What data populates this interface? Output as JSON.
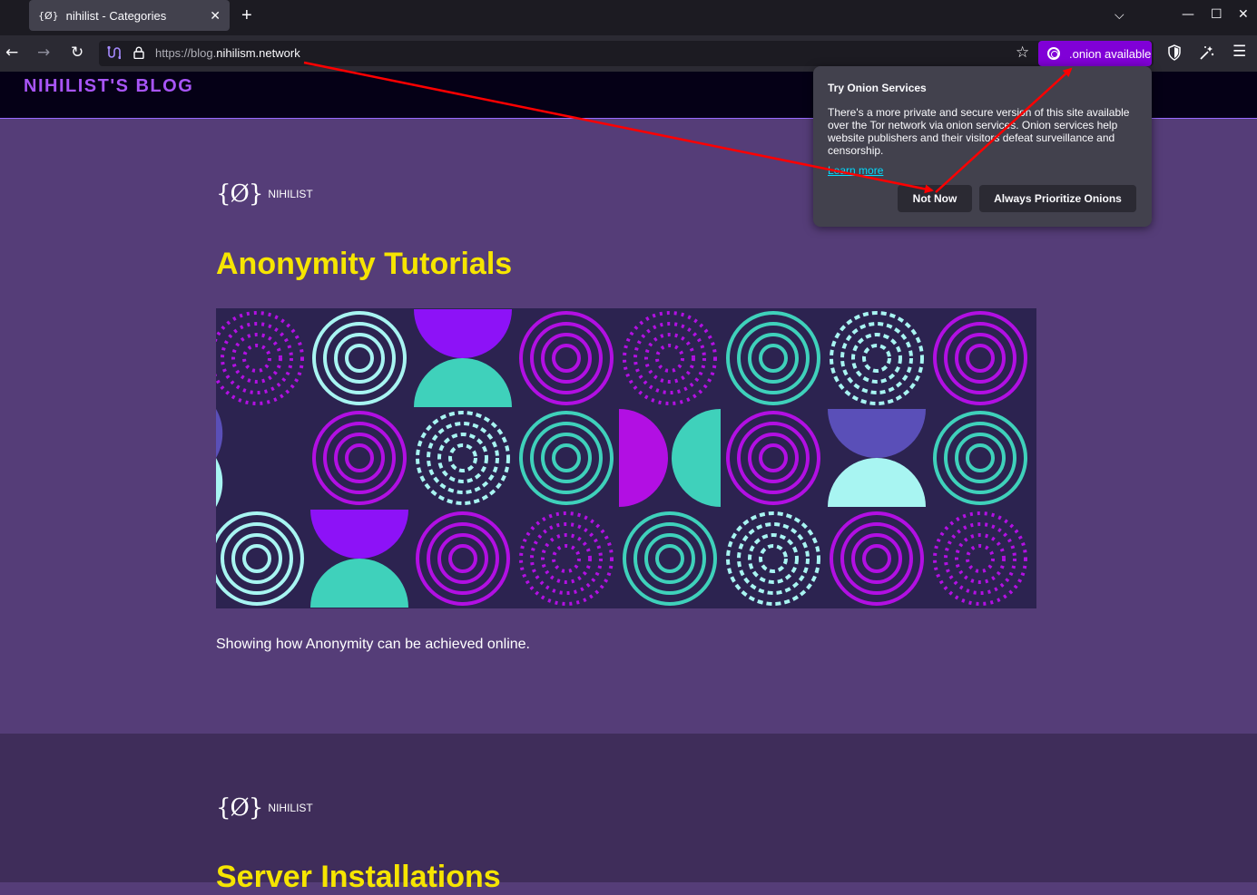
{
  "browser": {
    "tab": {
      "favicon": "{Ø}",
      "title": "nihilist - Categories",
      "close": "✕"
    },
    "new_tab": "+",
    "tabs_list": "⌵",
    "window_controls": {
      "minimize": "—",
      "maximize": "☐",
      "close": "✕"
    },
    "nav": {
      "back": "←",
      "forward": "→",
      "reload": "↻"
    },
    "url": {
      "prefix": "https://blog.",
      "domain": "nihilism.network"
    },
    "onion_badge": ".onion available",
    "icons": [
      "circuit-icon",
      "lock-icon",
      "bookmark-star-icon",
      "onion-icon",
      "shield-icon",
      "new-identity-icon",
      "hamburger-menu-icon"
    ],
    "accent_color": "#8000d7"
  },
  "site": {
    "title": "NIHILIST'S BLOG",
    "posts": [
      {
        "author_logo": "{Ø}",
        "author": "NIHILIST",
        "title": "Anonymity Tutorials",
        "excerpt": "Showing how Anonymity can be achieved online."
      },
      {
        "author_logo": "{Ø}",
        "author": "NIHILIST",
        "title": "Server Installations"
      }
    ]
  },
  "popup": {
    "heading": "Try Onion Services",
    "body": "There's a more private and secure version of this site available over the Tor network via onion services. Onion services help website publishers and their visitors defeat surveillance and censorship.",
    "learn_more": "Learn more",
    "not_now": "Not Now",
    "always_prioritize": "Always Prioritize Onions"
  },
  "colors": {
    "site_title": "#a855f7",
    "post_title": "#f6e500",
    "section_bg": "#553d78",
    "annotation_arrow": "#ff0000"
  }
}
